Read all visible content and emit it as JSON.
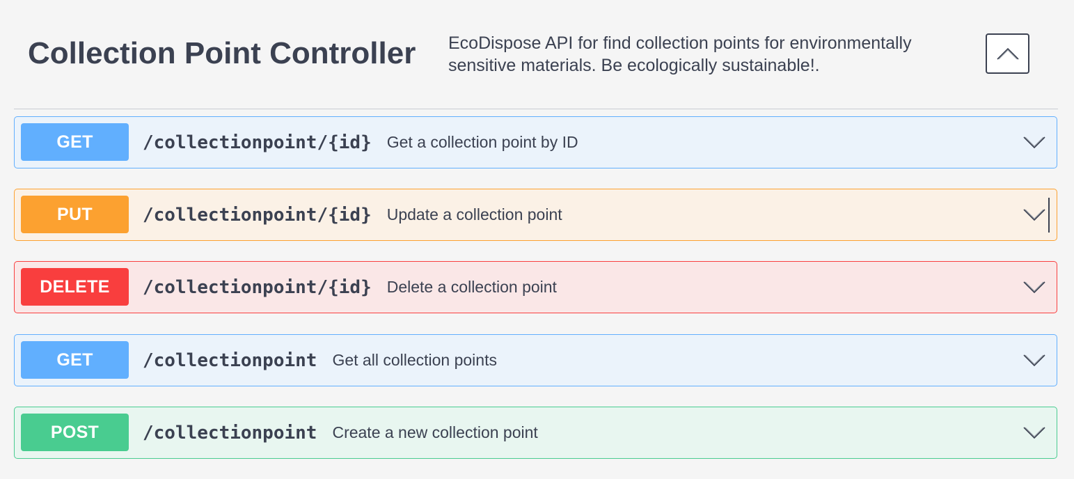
{
  "section": {
    "title": "Collection Point Controller",
    "description": "EcoDispose API for find collection points for environmentally sensitive materials. Be ecologically sustainable!."
  },
  "operations": [
    {
      "method": "GET",
      "path": "/collectionpoint/{id}",
      "summary": "Get a collection point by ID",
      "color": "#61affe"
    },
    {
      "method": "PUT",
      "path": "/collectionpoint/{id}",
      "summary": "Update a collection point",
      "color": "#fca130"
    },
    {
      "method": "DELETE",
      "path": "/collectionpoint/{id}",
      "summary": "Delete a collection point",
      "color": "#f93e3e"
    },
    {
      "method": "GET",
      "path": "/collectionpoint",
      "summary": "Get all collection points",
      "color": "#61affe"
    },
    {
      "method": "POST",
      "path": "/collectionpoint",
      "summary": "Create a new collection point",
      "color": "#49cc90"
    }
  ],
  "icons": {
    "collapse": "chevron-up-icon",
    "expand": "chevron-down-icon"
  }
}
